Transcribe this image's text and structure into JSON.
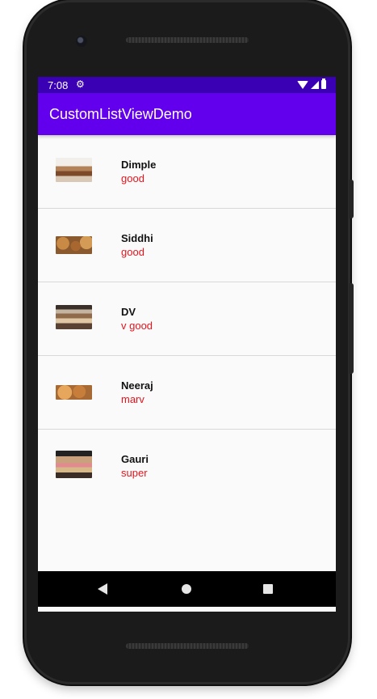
{
  "status_bar": {
    "time": "7:08",
    "icons": [
      "settings-gear-icon",
      "wifi-icon",
      "cell-signal-icon",
      "battery-icon"
    ]
  },
  "app_bar": {
    "title": "CustomListViewDemo",
    "color": "#6200ee",
    "status_color": "#3a00b3"
  },
  "list": {
    "items": [
      {
        "name": "Dimple",
        "desc": "good",
        "image": "bakery-thumbnail"
      },
      {
        "name": "Siddhi",
        "desc": "good",
        "image": "bread-thumbnail"
      },
      {
        "name": "DV",
        "desc": "v good",
        "image": "pastry-case-thumbnail"
      },
      {
        "name": "Neeraj",
        "desc": "marv",
        "image": "croissant-thumbnail"
      },
      {
        "name": "Gauri",
        "desc": "super",
        "image": "cake-display-thumbnail"
      }
    ],
    "desc_color": "#e4141e"
  },
  "nav_bar": {
    "icons": [
      "back-icon",
      "home-icon",
      "recents-icon"
    ]
  }
}
